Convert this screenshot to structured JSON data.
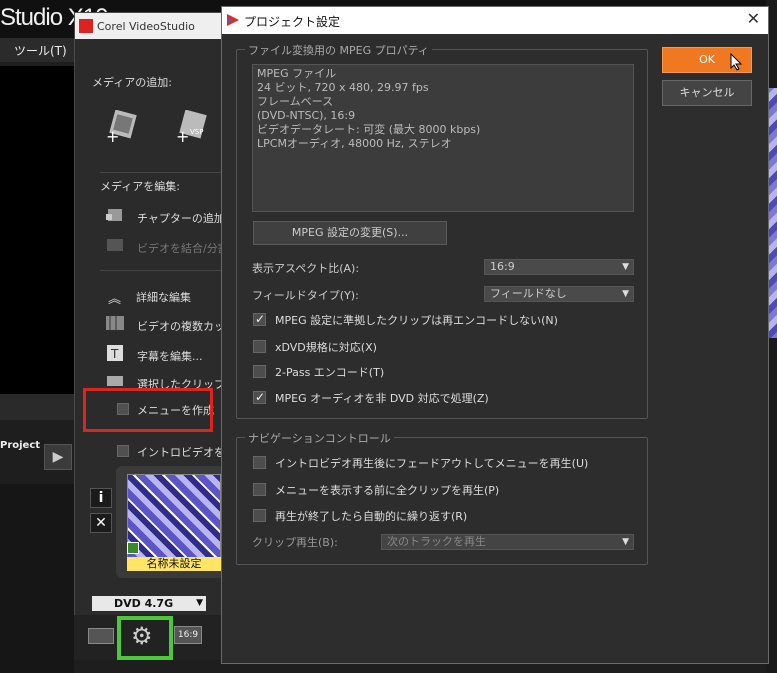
{
  "background_app": {
    "logo": "Studio X10",
    "menu_tools": "ツール(T)",
    "project_label": "Project"
  },
  "corel_window": {
    "title": "Corel VideoStudio",
    "add_media_heading": "メディアの追加:",
    "edit_media_heading": "メディアを編集:",
    "chapter_add": "チャプターの追加/編",
    "video_merge": "ビデオを結合/分割",
    "detailed_edit": "詳細な編集",
    "multi_cut": "ビデオの複数カット",
    "edit_subtitles": "字幕を編集...",
    "selected_clip": "選択したクリップを",
    "create_menu": "メニューを作成",
    "intro_video": "イントロビデオを再生",
    "menu_name": "名称未設定",
    "info_button": "i",
    "delete_button": "✕",
    "disc_type": "DVD 4.7G",
    "aspect_icon": "16:9"
  },
  "dialog": {
    "title": "プロジェクト設定",
    "close_label": "✕",
    "mpeg_group_legend": "ファイル変換用の MPEG プロパティ",
    "file_info": [
      "MPEG ファイル",
      "24 ビット, 720 x 480, 29.97 fps",
      "フレームベース",
      "(DVD-NTSC),  16:9",
      "ビデオデータレート: 可変 (最大  8000 kbps)",
      "LPCMオーディオ, 48000 Hz, ステレオ"
    ],
    "mpeg_settings_button": "MPEG 設定の変更(S)...",
    "aspect_label": "表示アスペクト比(A):",
    "aspect_value": "16:9",
    "field_label": "フィールドタイプ(Y):",
    "field_value": "フィールドなし",
    "checkboxes": [
      {
        "label": "MPEG 設定に準拠したクリップは再エンコードしない(N)",
        "checked": true
      },
      {
        "label": "xDVD規格に対応(X)",
        "checked": false
      },
      {
        "label": "2-Pass エンコード(T)",
        "checked": false
      },
      {
        "label": "MPEG オーディオを非 DVD 対応で処理(Z)",
        "checked": true
      }
    ],
    "nav_group_legend": "ナビゲーションコントロール",
    "nav_checkboxes": [
      {
        "label": "イントロビデオ再生後にフェードアウトしてメニューを再生(U)",
        "checked": false
      },
      {
        "label": "メニューを表示する前に全クリップを再生(P)",
        "checked": false
      },
      {
        "label": "再生が終了したら自動的に繰り返す(R)",
        "checked": false
      }
    ],
    "clip_play_label": "クリップ再生(B):",
    "clip_play_value": "次のトラックを再生",
    "ok_label": "OK",
    "cancel_label": "キャンセル"
  },
  "colors": {
    "ok_button": "#f07820",
    "highlight_red": "#e1231e",
    "highlight_green": "#4ec83a"
  }
}
